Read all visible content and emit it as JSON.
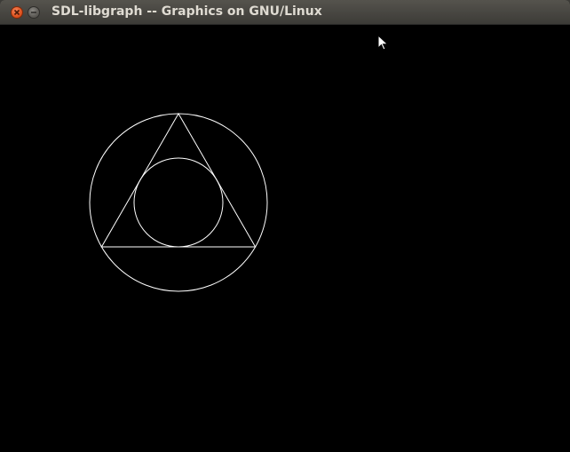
{
  "window": {
    "title": "SDL-libgraph -- Graphics on GNU/Linux",
    "close_icon": "close-icon",
    "minimize_icon": "minimize-icon"
  },
  "canvas": {
    "background": "#000000",
    "stroke": "#ffffff",
    "shapes": [
      "outer-circle",
      "triangle",
      "inner-circle"
    ]
  },
  "cursor": {
    "icon": "arrow-cursor-icon"
  }
}
